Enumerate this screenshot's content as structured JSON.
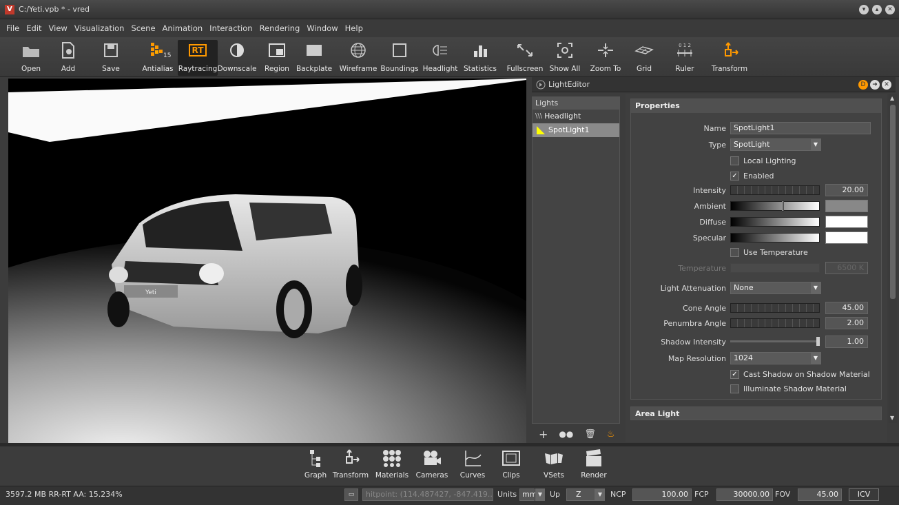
{
  "window": {
    "title": "C:/Yeti.vpb * - vred",
    "app_letter": "V"
  },
  "menu": [
    "File",
    "Edit",
    "View",
    "Visualization",
    "Scene",
    "Animation",
    "Interaction",
    "Rendering",
    "Window",
    "Help"
  ],
  "toolbar": {
    "open": "Open",
    "add": "Add",
    "save": "Save",
    "antialias": "Antialias",
    "antialias_badge": "15",
    "raytracing": "Raytracing",
    "rt_badge": "RT",
    "downscale": "Downscale",
    "region": "Region",
    "backplate": "Backplate",
    "wireframe": "Wireframe",
    "boundings": "Boundings",
    "headlight": "Headlight",
    "statistics": "Statistics",
    "fullscreen": "Fullscreen",
    "show_all": "Show All",
    "zoom_to": "Zoom To",
    "grid": "Grid",
    "ruler": "Ruler",
    "ruler_digits": "0 1 2",
    "transform": "Transform"
  },
  "viewport": {
    "plate_text": "Yeti"
  },
  "light_editor": {
    "title": "LightEditor",
    "lights_header": "Lights",
    "lights": [
      {
        "name": "Headlight",
        "selected": false
      },
      {
        "name": "SpotLight1",
        "selected": true
      }
    ],
    "properties_header": "Properties",
    "name_label": "Name",
    "name_value": "SpotLight1",
    "type_label": "Type",
    "type_value": "SpotLight",
    "local_lighting": {
      "label": "Local Lighting",
      "checked": false
    },
    "enabled": {
      "label": "Enabled",
      "checked": true
    },
    "intensity": {
      "label": "Intensity",
      "value": "20.00"
    },
    "ambient_label": "Ambient",
    "ambient_level": 0.7,
    "diffuse_label": "Diffuse",
    "specular_label": "Specular",
    "use_temperature": {
      "label": "Use Temperature",
      "checked": false
    },
    "temperature": {
      "label": "Temperature",
      "value": "6500 K"
    },
    "attenuation": {
      "label": "Light Attenuation",
      "value": "None"
    },
    "cone_angle": {
      "label": "Cone Angle",
      "value": "45.00"
    },
    "penumbra_angle": {
      "label": "Penumbra Angle",
      "value": "2.00"
    },
    "shadow_intensity": {
      "label": "Shadow Intensity",
      "value": "1.00"
    },
    "map_resolution": {
      "label": "Map Resolution",
      "value": "1024"
    },
    "cast_shadow": {
      "label": "Cast Shadow on Shadow Material",
      "checked": true
    },
    "illuminate_shadow": {
      "label": "Illuminate Shadow Material",
      "checked": false
    },
    "area_light_header": "Area Light"
  },
  "dock": [
    "Graph",
    "Transform",
    "Materials",
    "Cameras",
    "Curves",
    "Clips",
    "VSets",
    "Render"
  ],
  "status": {
    "memory": "3597.2 MB  RR-RT AA: 15.234%",
    "hitpoint": "hitpoint: (114.487427, -847.419...",
    "units_label": "Units",
    "units_value": "mm",
    "up_label": "Up",
    "up_value": "Z",
    "ncp_label": "NCP",
    "ncp_value": "100.00",
    "fcp_label": "FCP",
    "fcp_value": "30000.00",
    "fov_label": "FOV",
    "fov_value": "45.00",
    "icv": "ICV"
  },
  "colors": {
    "accent": "#ff9900",
    "active_tool": "#222222",
    "viewport_bg": "#000000"
  }
}
